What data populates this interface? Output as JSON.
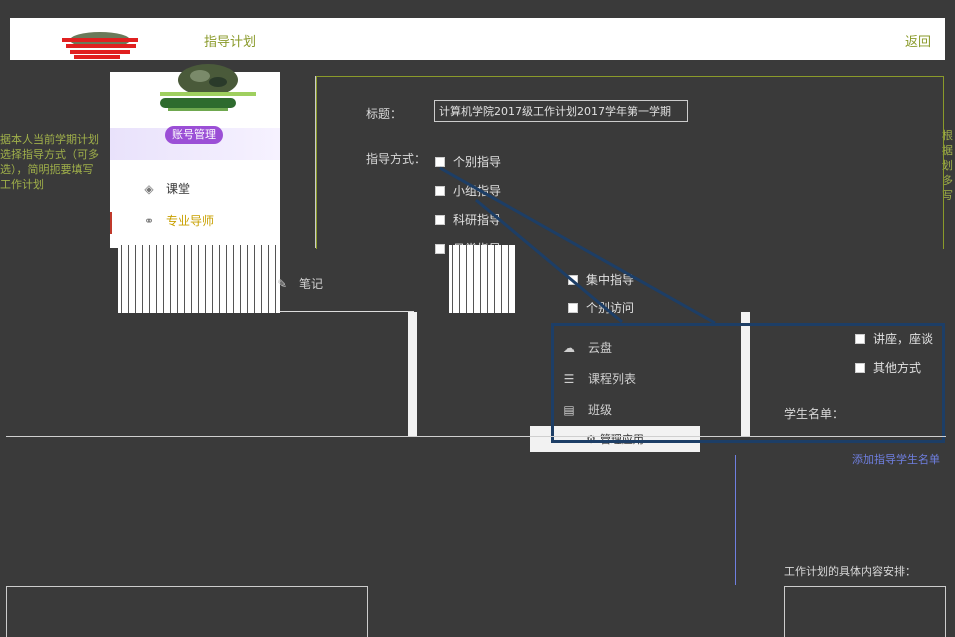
{
  "header": {
    "title": "指导计划",
    "back": "返回"
  },
  "left_description": "据本人当前学期计划选择指导方式（可多选），简明扼要填写工作计划",
  "right_description": "根据划多写",
  "user_menu": {
    "account_button": "账号管理",
    "items": [
      {
        "icon": "cube-icon",
        "label": "课堂"
      },
      {
        "icon": "link-icon",
        "label": "专业导师"
      },
      {
        "icon": "pencil-icon",
        "label": "笔记"
      }
    ],
    "items_bottom": [
      {
        "icon": "cloud-icon",
        "label": "云盘"
      },
      {
        "icon": "list-icon",
        "label": "课程列表"
      },
      {
        "icon": "card-icon",
        "label": "班级"
      }
    ],
    "manage_app": "管理应用"
  },
  "form": {
    "title_label": "标题：",
    "title_value": "计算机学院2017级工作计划2017学年第一学期",
    "method_label": "指导方式：",
    "methods": [
      "个别指导",
      "小组指导",
      "科研指导",
      "日常指导",
      "集中指导",
      "个别访问"
    ],
    "methods_right": [
      "讲座，座谈",
      "其他方式"
    ],
    "student_list_label": "学生名单：",
    "add_students_link": "添加指导学生名单",
    "plan_label": "工作计划的具体内容安排："
  },
  "colors": {
    "accent": "#8a9a2a",
    "background": "#3a3a3a",
    "blue_annotation": "#1d3e66",
    "account_button": "#9b4fd6"
  }
}
